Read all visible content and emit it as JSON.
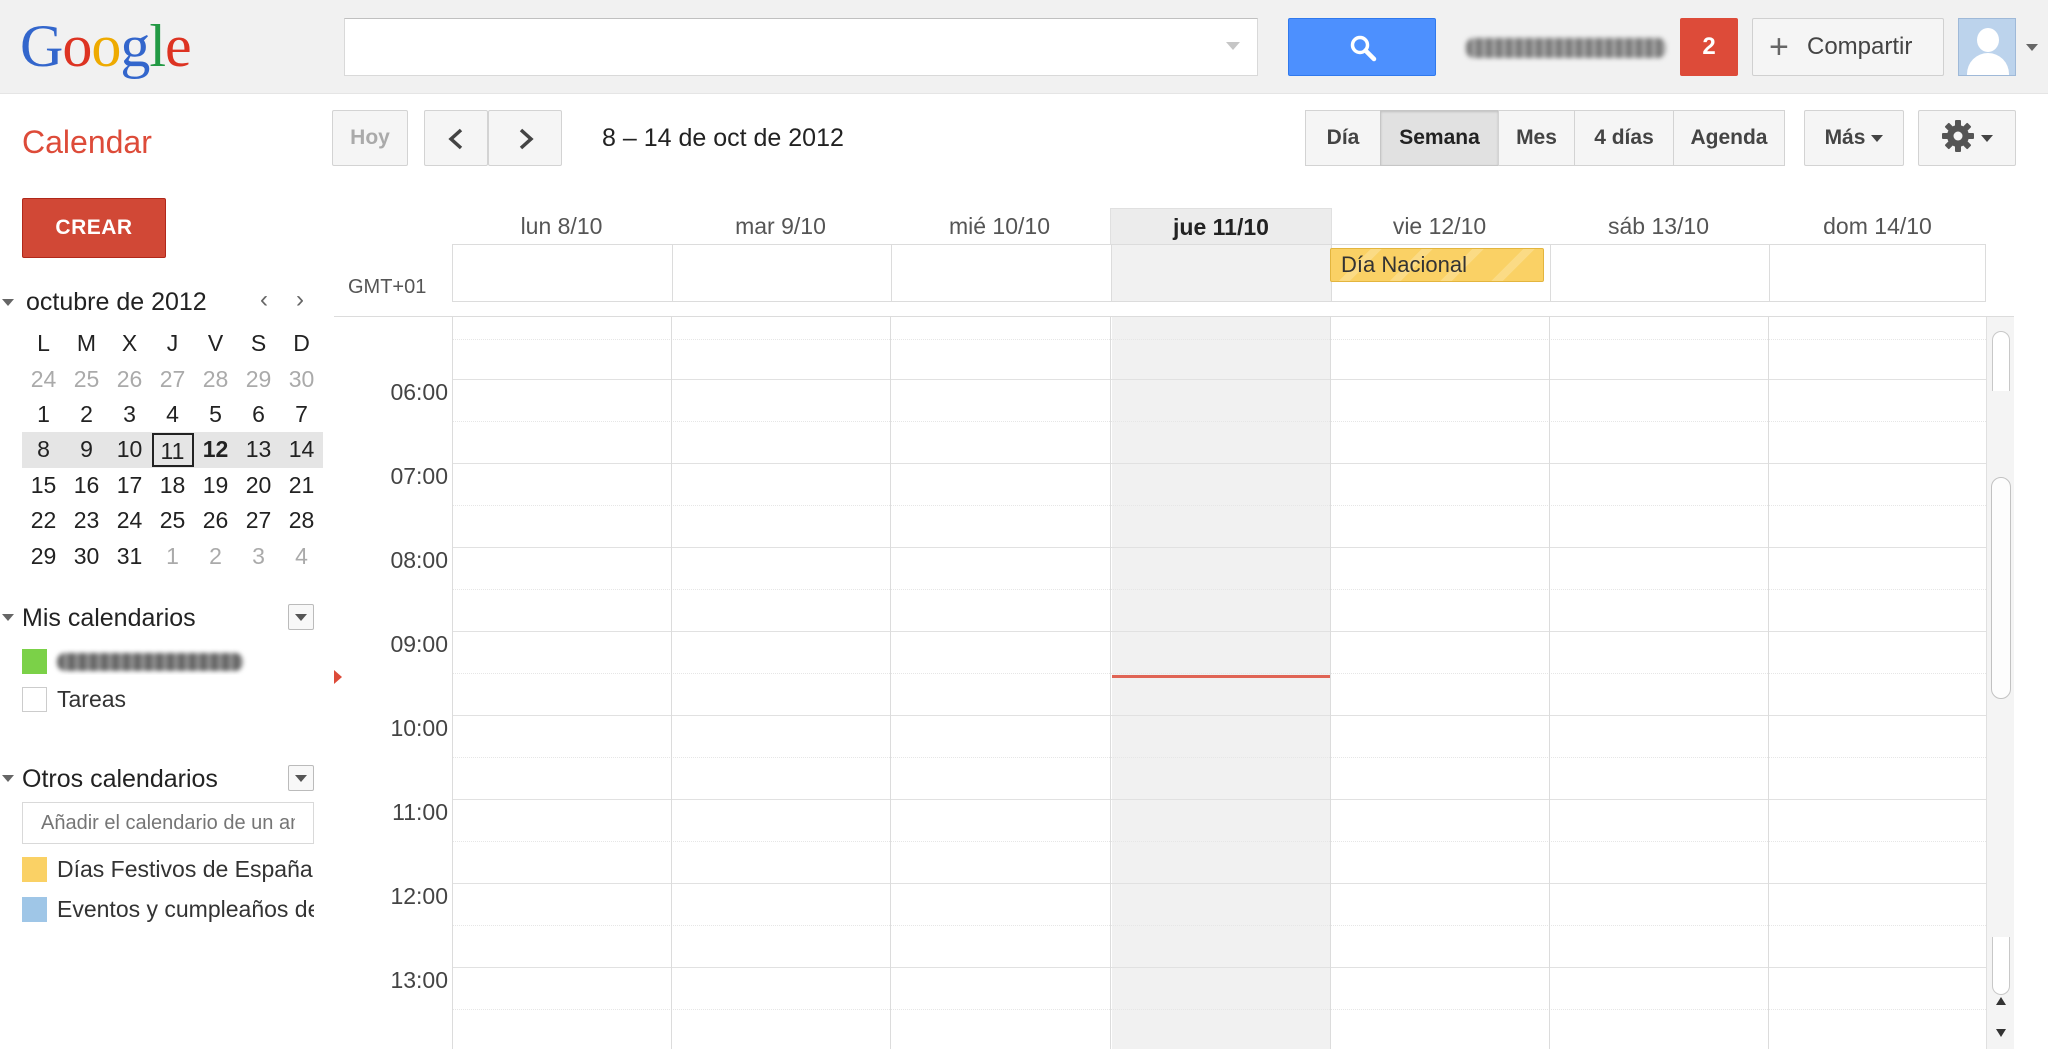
{
  "header": {
    "logo_letters": [
      "G",
      "o",
      "o",
      "g",
      "l",
      "e"
    ],
    "search": {
      "placeholder": "",
      "value": ""
    },
    "notification_count": "2",
    "share_label": "Compartir",
    "share_icon": "plus-icon"
  },
  "toolbar": {
    "app_title": "Calendar",
    "today_label": "Hoy",
    "date_range": "8 – 14 de oct de 2012",
    "views": [
      {
        "label": "Día",
        "active": false
      },
      {
        "label": "Semana",
        "active": true
      },
      {
        "label": "Mes",
        "active": false
      },
      {
        "label": "4 días",
        "active": false
      },
      {
        "label": "Agenda",
        "active": false
      }
    ],
    "more_label": "Más",
    "settings_icon": "gear-icon"
  },
  "sidebar": {
    "create_label": "CREAR",
    "mini_calendar": {
      "title": "octubre de 2012",
      "weekdays": [
        "L",
        "M",
        "X",
        "J",
        "V",
        "S",
        "D"
      ],
      "weeks": [
        [
          "24",
          "25",
          "26",
          "27",
          "28",
          "29",
          "30"
        ],
        [
          "1",
          "2",
          "3",
          "4",
          "5",
          "6",
          "7"
        ],
        [
          "8",
          "9",
          "10",
          "11",
          "12",
          "13",
          "14"
        ],
        [
          "15",
          "16",
          "17",
          "18",
          "19",
          "20",
          "21"
        ],
        [
          "22",
          "23",
          "24",
          "25",
          "26",
          "27",
          "28"
        ],
        [
          "29",
          "30",
          "31",
          "1",
          "2",
          "3",
          "4"
        ]
      ]
    },
    "my_calendars": {
      "title": "Mis calendarios",
      "items": [
        {
          "label": "",
          "color": "#7bd148",
          "redacted": true
        },
        {
          "label": "Tareas",
          "color": "#ffffff"
        }
      ]
    },
    "other_calendars": {
      "title": "Otros calendarios",
      "add_placeholder": "Añadir el calendario de un amigo",
      "items": [
        {
          "label": "Días Festivos de España",
          "color": "#fad165"
        },
        {
          "label": "Eventos y cumpleaños de contactos",
          "color": "#9fc6e7"
        }
      ]
    }
  },
  "week": {
    "timezone": "GMT+01",
    "days": [
      {
        "label": "lun 8/10",
        "today": false
      },
      {
        "label": "mar 9/10",
        "today": false
      },
      {
        "label": "mié 10/10",
        "today": false
      },
      {
        "label": "jue 11/10",
        "today": true
      },
      {
        "label": "vie 12/10",
        "today": false
      },
      {
        "label": "sáb 13/10",
        "today": false
      },
      {
        "label": "dom 14/10",
        "today": false
      }
    ],
    "all_day_events": [
      {
        "day": "vie 12/10",
        "title": "Día Nacional",
        "color": "#fad165"
      }
    ],
    "hours": [
      "06:00",
      "07:00",
      "08:00",
      "09:00",
      "10:00",
      "11:00",
      "12:00",
      "13:00"
    ]
  }
}
